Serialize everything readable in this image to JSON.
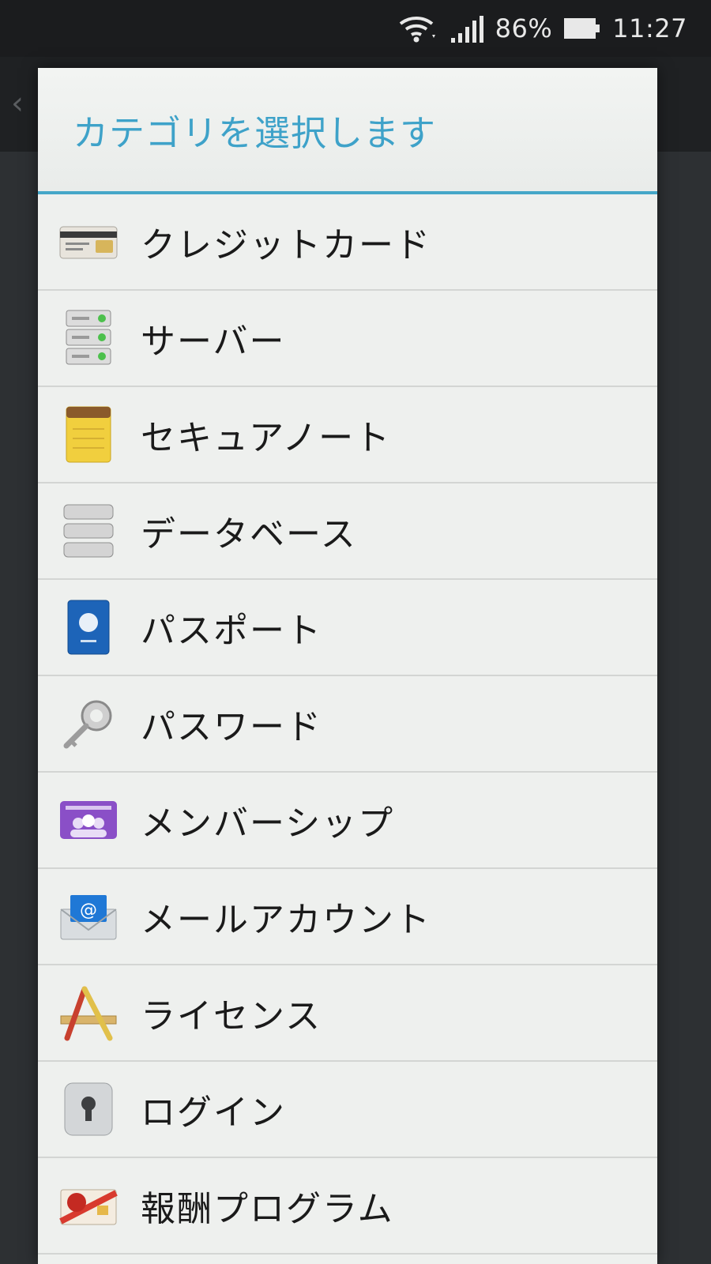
{
  "status_bar": {
    "battery_percent": "86%",
    "time": "11:27",
    "icons": [
      "wifi-icon",
      "signal-icon",
      "battery-icon"
    ]
  },
  "dialog": {
    "title": "カテゴリを選択します",
    "accent_color": "#45a7c8",
    "items": [
      {
        "label": "クレジットカード",
        "icon": "credit-card-icon"
      },
      {
        "label": "サーバー",
        "icon": "server-icon"
      },
      {
        "label": "セキュアノート",
        "icon": "notepad-icon"
      },
      {
        "label": "データベース",
        "icon": "database-icon"
      },
      {
        "label": "パスポート",
        "icon": "passport-icon"
      },
      {
        "label": "パスワード",
        "icon": "key-icon"
      },
      {
        "label": "メンバーシップ",
        "icon": "membership-card-icon"
      },
      {
        "label": "メールアカウント",
        "icon": "mail-icon"
      },
      {
        "label": "ライセンス",
        "icon": "license-icon"
      },
      {
        "label": "ログイン",
        "icon": "lock-icon"
      },
      {
        "label": "報酬プログラム",
        "icon": "reward-icon"
      }
    ]
  }
}
